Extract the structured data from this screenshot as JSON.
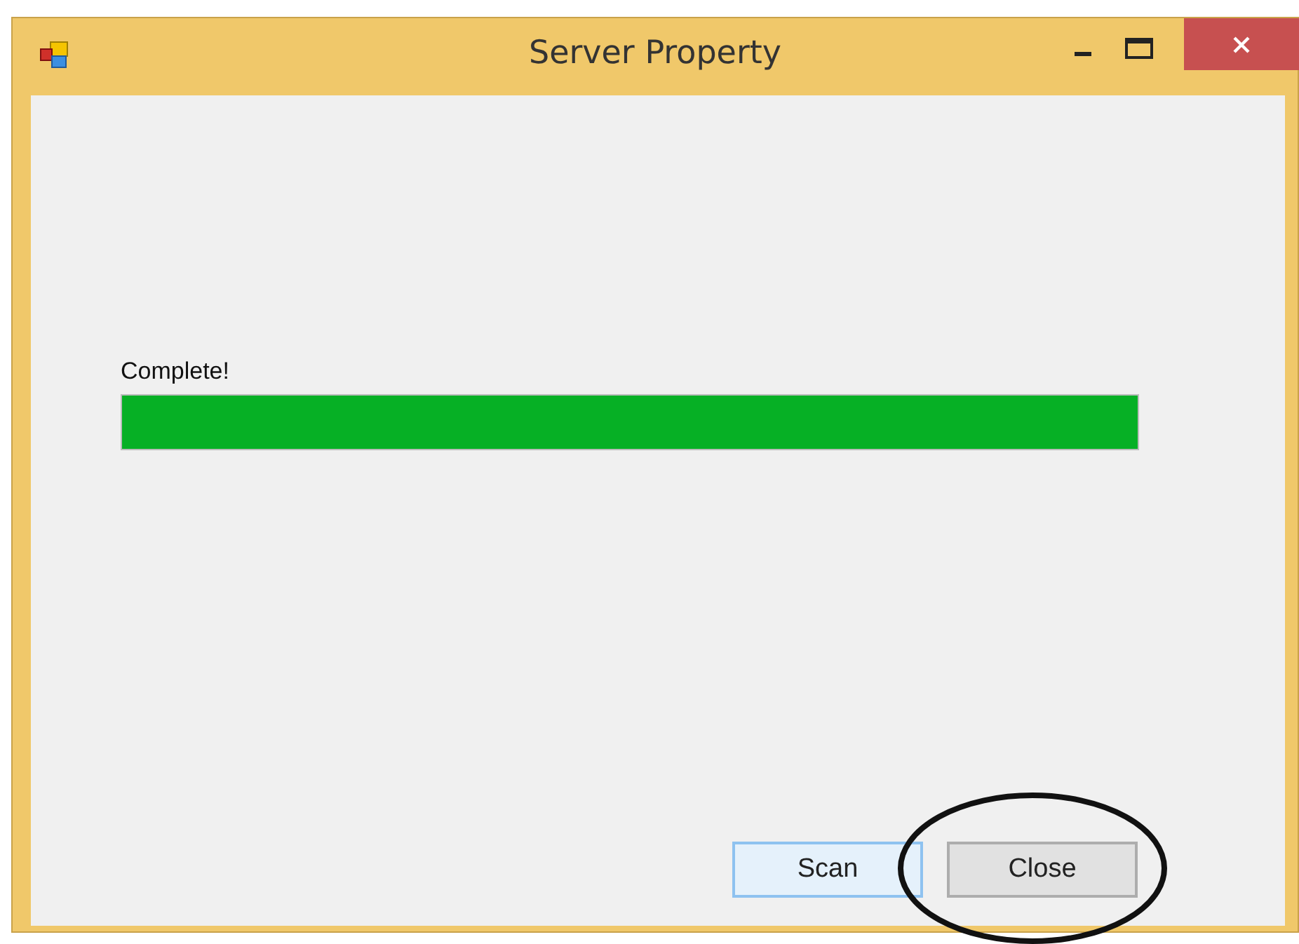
{
  "window": {
    "title": "Server Property"
  },
  "progress": {
    "label": "Complete!",
    "level": 1
  },
  "buttons": [
    {
      "label": "Scan",
      "focused": true
    },
    {
      "label": "Close",
      "focused": false,
      "annotated": true
    }
  ]
}
